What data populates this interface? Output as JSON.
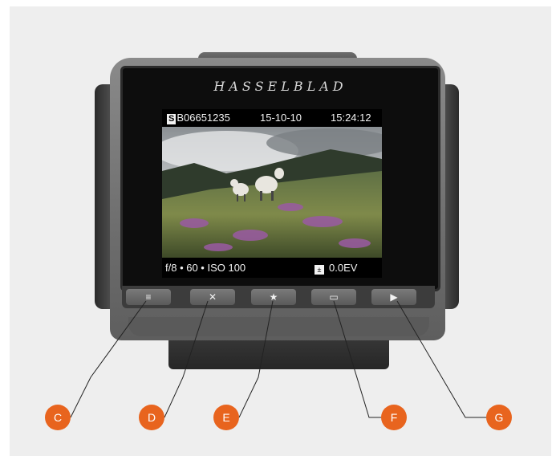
{
  "brand": "HASSELBLAD",
  "lcd": {
    "mode_badge": "S",
    "serial": "B06651235",
    "date": "15-10-10",
    "time": "15:24:12",
    "exposure": "f/8 • 60 • ISO 100",
    "ev_value": "0.0EV"
  },
  "buttons": [
    {
      "glyph": "≡",
      "icon": "menu-icon"
    },
    {
      "glyph": "✕",
      "icon": "delete-icon"
    },
    {
      "glyph": "★",
      "icon": "star-icon"
    },
    {
      "glyph": "▭",
      "icon": "rectangle-icon"
    },
    {
      "glyph": "▶",
      "icon": "play-icon"
    }
  ],
  "callouts": [
    "C",
    "D",
    "E",
    "F",
    "G"
  ],
  "colors": {
    "callout": "#e8641e",
    "leader_line": "#222222",
    "background": "#eeeeee"
  }
}
